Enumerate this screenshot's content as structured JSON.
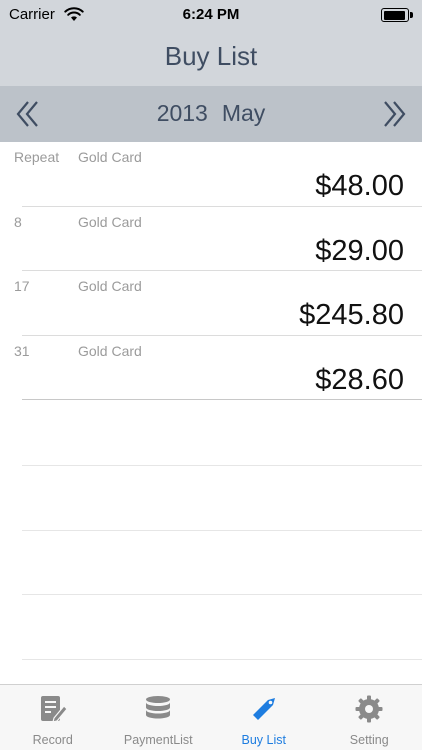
{
  "status_bar": {
    "carrier": "Carrier",
    "time": "6:24 PM",
    "battery_level": 0.95
  },
  "nav": {
    "title": "Buy List"
  },
  "month_bar": {
    "year": "2013",
    "month": "May"
  },
  "entries": [
    {
      "day": "Repeat",
      "card": "Gold Card",
      "amount": "$48.00"
    },
    {
      "day": "8",
      "card": "Gold Card",
      "amount": "$29.00"
    },
    {
      "day": "17",
      "card": "Gold Card",
      "amount": "$245.80"
    },
    {
      "day": "31",
      "card": "Gold Card",
      "amount": "$28.60"
    }
  ],
  "tabs": [
    {
      "label": "Record",
      "icon": "record-icon",
      "active": false
    },
    {
      "label": "PaymentList",
      "icon": "database-icon",
      "active": false
    },
    {
      "label": "Buy List",
      "icon": "tag-icon",
      "active": true
    },
    {
      "label": "Setting",
      "icon": "gear-icon",
      "active": false
    }
  ],
  "colors": {
    "bar": "#d2d6db",
    "month_bar": "#bcc2c9",
    "title": "#3f4d62",
    "active_tab": "#1e7de0",
    "inactive_tab": "#8a8a8a"
  }
}
